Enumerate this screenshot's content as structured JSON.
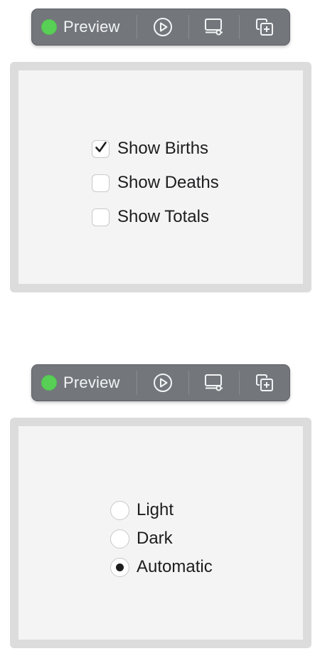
{
  "colors": {
    "toolbar_bg": "#73777c",
    "status_green": "#58cf55",
    "panel_border": "#dcdcdc",
    "panel_bg": "#f4f4f4",
    "text": "#1d1d1f"
  },
  "previews": [
    {
      "toolbar": {
        "status": "live",
        "preview_label": "Preview",
        "icons": [
          "status-dot-icon",
          "play-circle-icon",
          "device-settings-icon",
          "duplicate-icon"
        ]
      },
      "checkboxes": [
        {
          "label": "Show Births",
          "checked": true
        },
        {
          "label": "Show Deaths",
          "checked": false
        },
        {
          "label": "Show Totals",
          "checked": false
        }
      ]
    },
    {
      "toolbar": {
        "status": "live",
        "preview_label": "Preview",
        "icons": [
          "status-dot-icon",
          "play-circle-icon",
          "device-settings-icon",
          "duplicate-icon"
        ]
      },
      "radios": [
        {
          "label": "Light",
          "selected": false
        },
        {
          "label": "Dark",
          "selected": false
        },
        {
          "label": "Automatic",
          "selected": true
        }
      ]
    }
  ]
}
